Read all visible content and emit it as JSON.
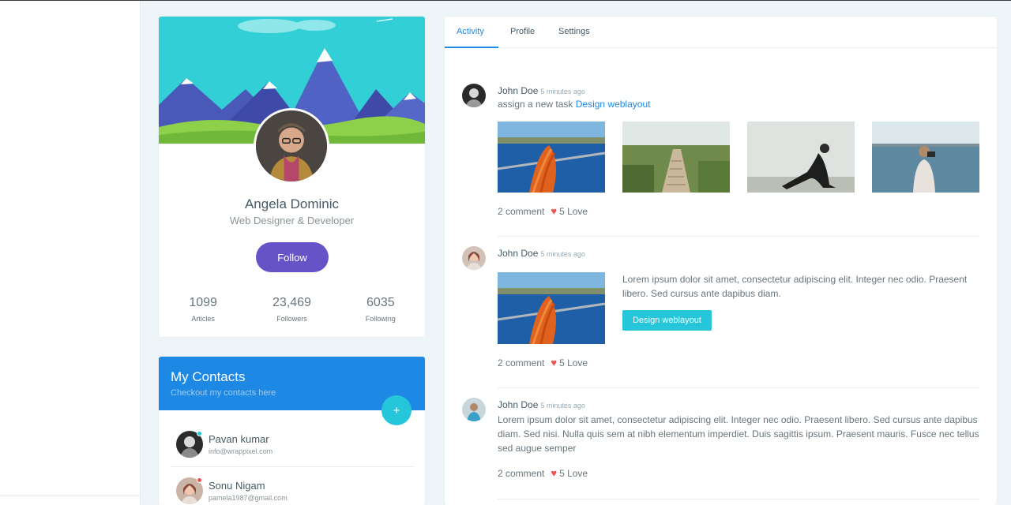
{
  "profile": {
    "name": "Angela Dominic",
    "role": "Web Designer & Developer",
    "follow_label": "Follow",
    "stats": [
      {
        "value": "1099",
        "label": "Articles"
      },
      {
        "value": "23,469",
        "label": "Followers"
      },
      {
        "value": "6035",
        "label": "Following"
      }
    ]
  },
  "contacts": {
    "title": "My Contacts",
    "subtitle": "Checkout my contacts here",
    "add_label": "+",
    "items": [
      {
        "name": "Pavan kumar",
        "email": "info@wrappixel.com",
        "status_color": "#26c6da"
      },
      {
        "name": "Sonu Nigam",
        "email": "pamela1987@gmail.com",
        "status_color": "#ef5350"
      }
    ]
  },
  "tabs": [
    "Activity",
    "Profile",
    "Settings"
  ],
  "activity": [
    {
      "author": "John Doe",
      "time": "5 minutes ago",
      "text": "assign a new task",
      "link": "Design weblayout",
      "comments": "2 comment",
      "love": "5 Love"
    },
    {
      "author": "John Doe",
      "time": "5 minutes ago",
      "text": "Lorem ipsum dolor sit amet, consectetur adipiscing elit. Integer nec odio. Praesent libero. Sed cursus ante dapibus diam.",
      "button": "Design weblayout",
      "comments": "2 comment",
      "love": "5 Love"
    },
    {
      "author": "John Doe",
      "time": "5 minutes ago",
      "text": "Lorem ipsum dolor sit amet, consectetur adipiscing elit. Integer nec odio. Praesent libero. Sed cursus ante dapibus diam. Sed nisi. Nulla quis sem at nibh elementum imperdiet. Duis sagittis ipsum. Praesent mauris. Fusce nec tellus sed augue semper",
      "comments": "2 comment",
      "love": "5 Love"
    }
  ],
  "colors": {
    "primary": "#1e88e5",
    "info": "#26c6da",
    "purple": "#6753c8",
    "danger": "#ef5350"
  }
}
